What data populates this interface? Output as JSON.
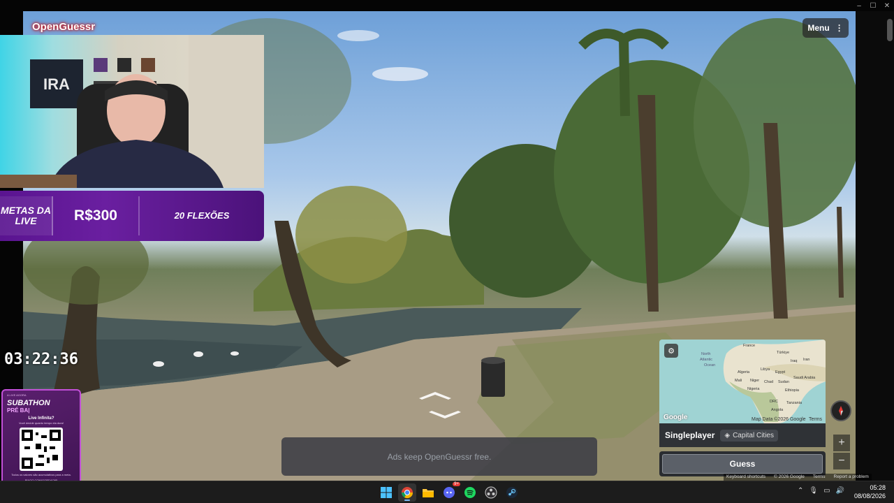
{
  "window": {
    "controls": [
      "–",
      "☐",
      "✕"
    ]
  },
  "game": {
    "brand": "OpenGuessr",
    "menu_label": "Menu",
    "ad_text": "Ads keep OpenGuessr free.",
    "mode_label": "Singleplayer",
    "mode_chip": "Capital Cities",
    "guess_label": "Guess",
    "map_attribution": "Map Data ©2026 Google",
    "map_terms": "Terms",
    "map_google": "Google",
    "zoom_in": "+",
    "zoom_out": "−",
    "map_labels": [
      "North Atlantic Ocean",
      "France",
      "Türkiye",
      "Iraq",
      "Iran",
      "Algeria",
      "Libya",
      "Egypt",
      "Saudi Arabia",
      "Mali",
      "Niger",
      "Chad",
      "Sudan",
      "Nigeria",
      "Ethiopia",
      "DRC",
      "Tanzania",
      "Angola"
    ],
    "footer_links": [
      "Keyboard shortcuts",
      "© 2026 Google",
      "Terms",
      "Report a problem"
    ]
  },
  "stream": {
    "goals_title": "METAS DA LIVE",
    "goals_amount": "R$300",
    "goals_target": "20 FLEXÕES",
    "timer": "03:22:36",
    "subathon": {
      "tiny": "A LIVE AGORA",
      "title": "SUBATHON",
      "subtitle": "PRÉ BA|",
      "question": "Live Infinita?",
      "desc": "Você decide quanto tempo ela dura!",
      "footer": "Todos os valores são acumulativos para a meta.",
      "url": "PIXGG.COM/GORDAO95"
    },
    "webcam_logo": "IRA"
  },
  "taskbar": {
    "apps": [
      "windows-start",
      "chrome",
      "file-explorer",
      "discord",
      "spotify",
      "obs",
      "steam"
    ],
    "discord_badge": "9+",
    "time": "05:28",
    "date": "08/08/2026"
  }
}
